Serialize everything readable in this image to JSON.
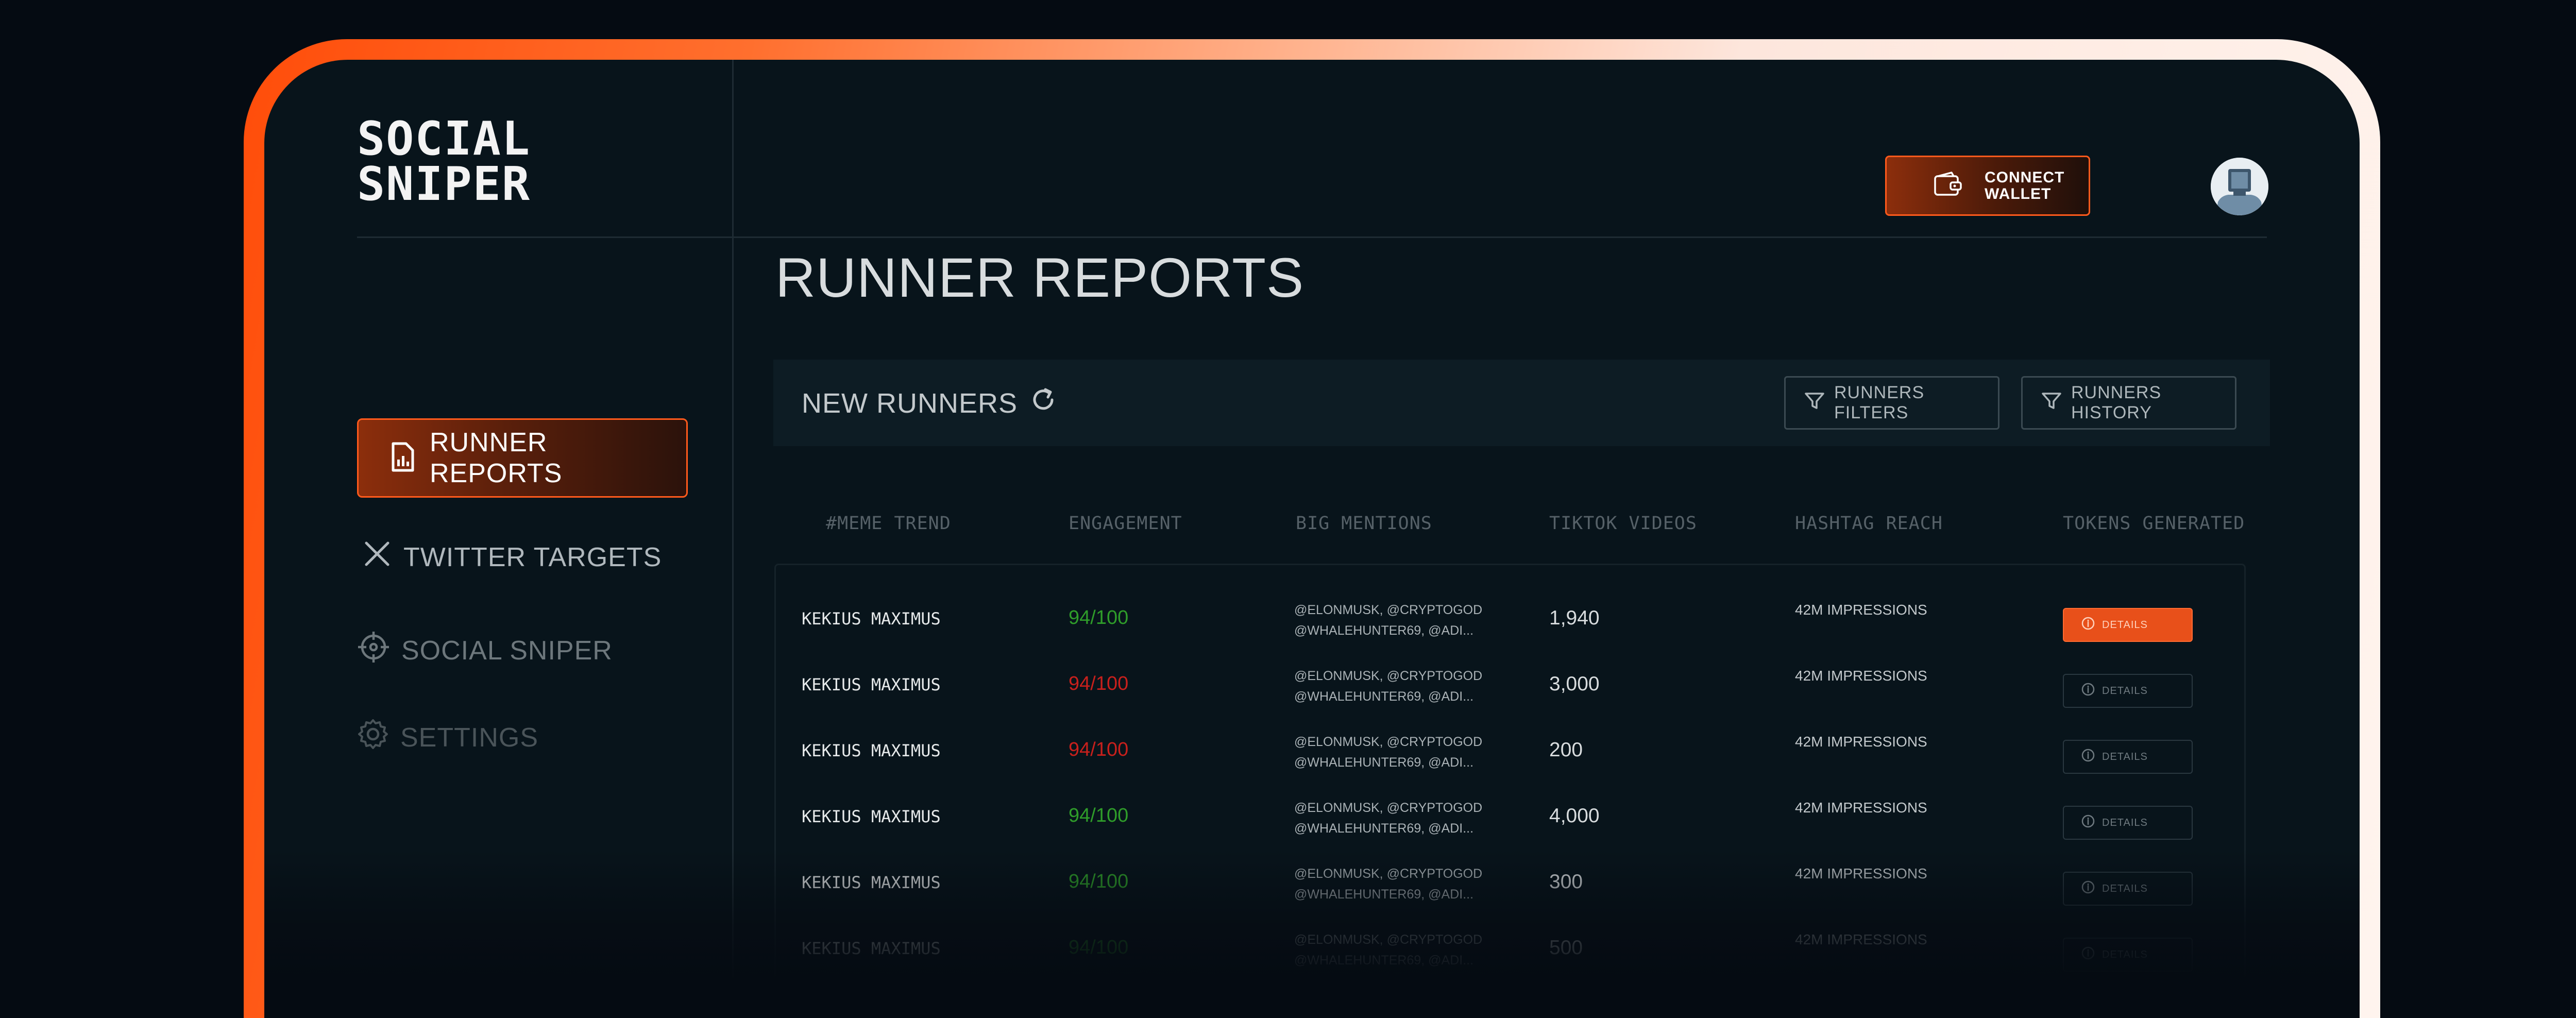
{
  "app": {
    "logo_line1": "SOCIAL",
    "logo_line2": "SNIPER"
  },
  "header": {
    "connect_wallet_label": "CONNECT\nWALLET",
    "wallet_icon": "wallet-icon",
    "avatar_icon": "user-avatar"
  },
  "sidebar": {
    "items": [
      {
        "label": "RUNNER REPORTS",
        "icon": "report-icon",
        "active": true
      },
      {
        "label": "TWITTER TARGETS",
        "icon": "x-icon",
        "active": false
      },
      {
        "label": "SOCIAL SNIPER",
        "icon": "crosshair-icon",
        "active": false
      },
      {
        "label": "SETTINGS",
        "icon": "gear-icon",
        "active": false
      }
    ]
  },
  "main": {
    "title": "RUNNER REPORTS",
    "section_label": "NEW RUNNERS",
    "refresh_icon": "refresh-icon",
    "filters_label": "RUNNERS FILTERS",
    "history_label": "RUNNERS HISTORY",
    "columns": [
      "#MEME TREND",
      "ENGAGEMENT",
      "BIG MENTIONS",
      "TIKTOK VIDEOS",
      "HASHTAG REACH",
      "TOKENS GENERATED"
    ],
    "rows": [
      {
        "name": "KEKIUS MAXIMUS",
        "engagement": "94/100",
        "engagement_status": "good",
        "mentions_line1": "@ELONMUSK, @CRYPTOGOD",
        "mentions_line2": "@WHALEHUNTER69, @ADI...",
        "tiktok": "1,940",
        "hashtag": "42M IMPRESSIONS",
        "details": "DETAILS",
        "details_active": true
      },
      {
        "name": "KEKIUS MAXIMUS",
        "engagement": "94/100",
        "engagement_status": "bad",
        "mentions_line1": "@ELONMUSK, @CRYPTOGOD",
        "mentions_line2": "@WHALEHUNTER69, @ADI...",
        "tiktok": "3,000",
        "hashtag": "42M IMPRESSIONS",
        "details": "DETAILS",
        "details_active": false
      },
      {
        "name": "KEKIUS MAXIMUS",
        "engagement": "94/100",
        "engagement_status": "bad",
        "mentions_line1": "@ELONMUSK, @CRYPTOGOD",
        "mentions_line2": "@WHALEHUNTER69, @ADI...",
        "tiktok": "200",
        "hashtag": "42M IMPRESSIONS",
        "details": "DETAILS",
        "details_active": false
      },
      {
        "name": "KEKIUS MAXIMUS",
        "engagement": "94/100",
        "engagement_status": "good",
        "mentions_line1": "@ELONMUSK, @CRYPTOGOD",
        "mentions_line2": "@WHALEHUNTER69, @ADI...",
        "tiktok": "4,000",
        "hashtag": "42M IMPRESSIONS",
        "details": "DETAILS",
        "details_active": false
      },
      {
        "name": "KEKIUS MAXIMUS",
        "engagement": "94/100",
        "engagement_status": "good",
        "mentions_line1": "@ELONMUSK, @CRYPTOGOD",
        "mentions_line2": "@WHALEHUNTER69, @ADI...",
        "tiktok": "300",
        "hashtag": "42M IMPRESSIONS",
        "details": "DETAILS",
        "details_active": false
      },
      {
        "name": "KEKIUS MAXIMUS",
        "engagement": "94/100",
        "engagement_status": "good",
        "mentions_line1": "@ELONMUSK, @CRYPTOGOD",
        "mentions_line2": "@WHALEHUNTER69, @ADI...",
        "tiktok": "500",
        "hashtag": "42M IMPRESSIONS",
        "details": "DETAILS",
        "details_active": false
      }
    ]
  },
  "colors": {
    "accent": "#ff5a1c",
    "good": "#2f9d2a",
    "bad": "#c8201c",
    "background": "#08141b"
  }
}
